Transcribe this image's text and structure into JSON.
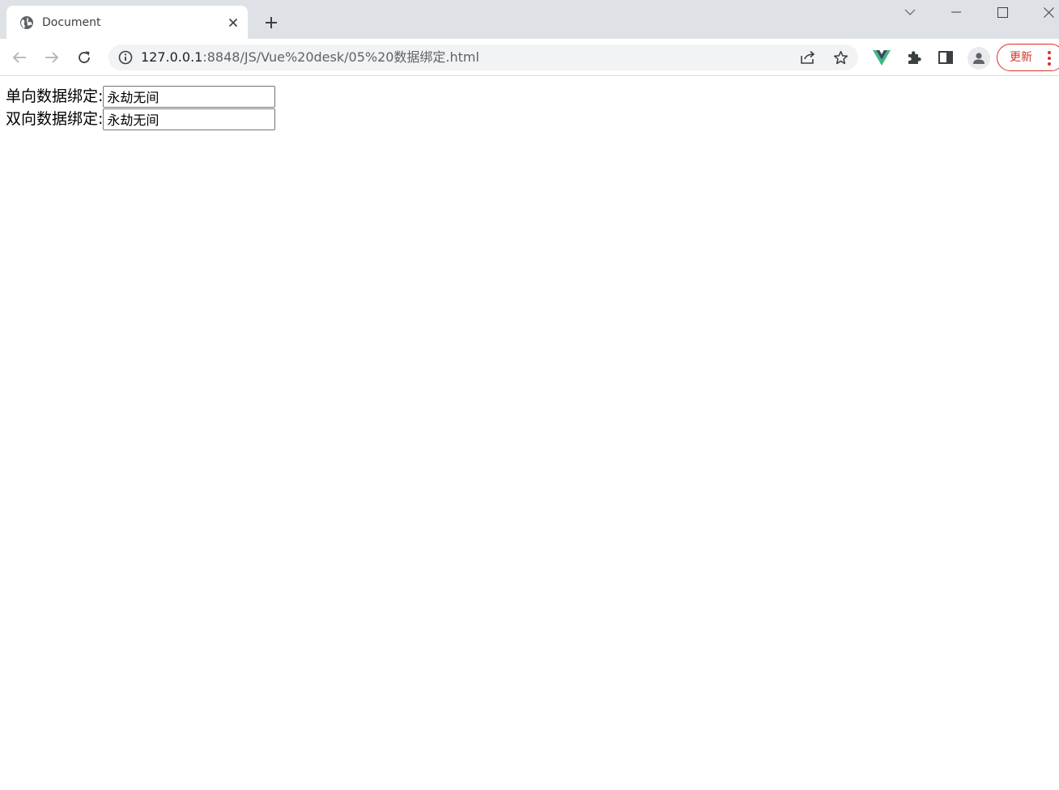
{
  "browser": {
    "tab": {
      "title": "Document",
      "favicon": "globe-icon"
    },
    "new_tab_icon": "plus-icon",
    "window_controls": [
      "tab-search-chevron-icon",
      "minimize-icon",
      "maximize-icon",
      "close-window-icon"
    ],
    "address": {
      "host": "127.0.0.1",
      "path": ":8848/JS/Vue%20desk/05%20数据绑定.html",
      "security_icon": "info-icon"
    },
    "toolbar_icons": [
      "back-arrow-icon",
      "forward-arrow-icon",
      "reload-icon",
      "share-icon",
      "star-icon",
      "vue-devtools-icon",
      "puzzle-extension-icon",
      "side-panel-icon",
      "profile-avatar-icon",
      "kebab-menu-icon"
    ],
    "update_button": {
      "label": "更新"
    }
  },
  "page": {
    "one_way": {
      "label": "单向数据绑定:",
      "value": "永劫无间"
    },
    "two_way": {
      "label": "双向数据绑定:",
      "value": "永劫无间"
    }
  },
  "colors": {
    "tabstrip_bg": "#dee1e6",
    "omnibox_bg": "#f1f3f4",
    "update_red": "#d93025",
    "vue_green": "#41b883",
    "vue_dark": "#35495e"
  }
}
